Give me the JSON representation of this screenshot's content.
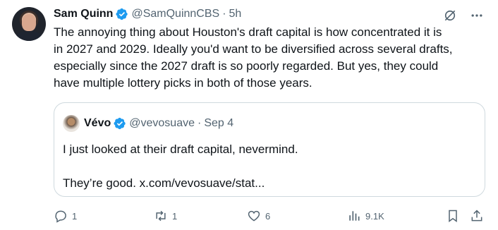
{
  "author": {
    "name": "Sam Quinn",
    "handle": "@SamQuinnCBS",
    "separator": "·",
    "time": "5h",
    "verified_color": "#1d9bf0"
  },
  "post": {
    "lines": [
      "The annoying thing about Houston's draft capital is how concentrated it is",
      "in 2027 and 2029. Ideally you'd want to be diversified across several drafts,",
      "especially since the 2027 draft is so poorly regarded. But yes, they could",
      "have multiple lottery picks in both of those years."
    ]
  },
  "quoted": {
    "name": "Vévo",
    "handle": "@vevosuave",
    "separator": "·",
    "time": "Sep 4",
    "line1": "I just looked at their draft capital, nevermind.",
    "line2": "They’re good. x.com/vevosuave/stat..."
  },
  "actions": {
    "replies": "1",
    "reposts": "1",
    "likes": "6",
    "views": "9.1K"
  },
  "icons": [
    "grok-icon",
    "more-icon",
    "reply-icon",
    "repost-icon",
    "like-icon",
    "views-icon",
    "bookmark-icon",
    "share-icon"
  ]
}
